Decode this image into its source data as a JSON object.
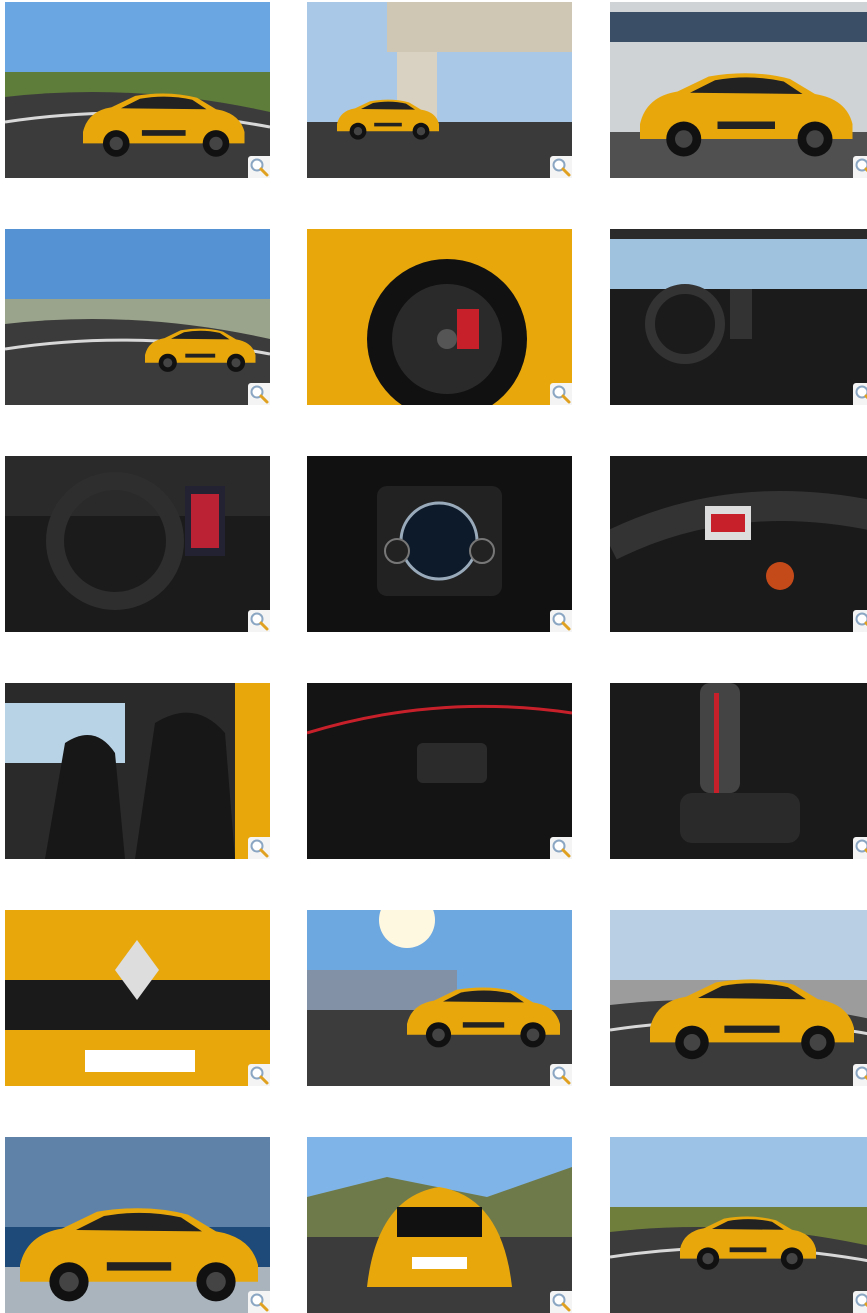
{
  "gallery": {
    "thumbnails": [
      {
        "subject": "car-on-track",
        "caption": ""
      },
      {
        "subject": "car-under-bridge",
        "caption": ""
      },
      {
        "subject": "car-side-pitlane",
        "caption": ""
      },
      {
        "subject": "car-rear-track",
        "caption": ""
      },
      {
        "subject": "wheel-closeup",
        "caption": ""
      },
      {
        "subject": "interior-dashboard",
        "caption": ""
      },
      {
        "subject": "steering-wheel-screen",
        "caption": ""
      },
      {
        "subject": "instrument-cluster",
        "caption": ""
      },
      {
        "subject": "steering-rs-badge",
        "caption": ""
      },
      {
        "subject": "front-seats",
        "caption": ""
      },
      {
        "subject": "door-panel",
        "caption": ""
      },
      {
        "subject": "gear-shifter",
        "caption": ""
      },
      {
        "subject": "front-grille",
        "caption": ""
      },
      {
        "subject": "car-front-stands",
        "caption": ""
      },
      {
        "subject": "car-front-track",
        "caption": ""
      },
      {
        "subject": "car-front-pits",
        "caption": ""
      },
      {
        "subject": "car-rear-view",
        "caption": ""
      },
      {
        "subject": "car-rear-track-2",
        "caption": ""
      }
    ],
    "zoom_icon": "magnifier-icon",
    "colors": {
      "car_yellow": "#e8a80c",
      "sky": "#5a93d6",
      "asphalt": "#3a3a3a",
      "interior": "#1e1e1e",
      "accent_red": "#c8202a"
    }
  }
}
